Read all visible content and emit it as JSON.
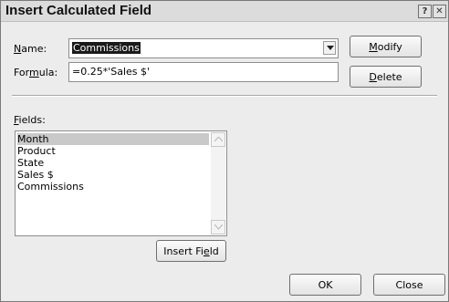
{
  "dialog": {
    "title": "Insert Calculated Field",
    "help_glyph": "?",
    "close_glyph": "✕"
  },
  "name_field": {
    "label_underlined": "N",
    "label_rest": "ame:",
    "value": "Commissions"
  },
  "formula_field": {
    "label_pre": "For",
    "label_underlined": "m",
    "label_post": "ula:",
    "value": "=0.25*'Sales $'"
  },
  "buttons": {
    "modify_underlined": "M",
    "modify_rest": "odify",
    "delete_underlined": "D",
    "delete_rest": "elete",
    "insert_field_pre": "Insert Fi",
    "insert_field_underlined": "e",
    "insert_field_post": "ld",
    "ok": "OK",
    "close": "Close"
  },
  "fields": {
    "label_underlined": "F",
    "label_rest": "ields:",
    "items": [
      "Month",
      "Product",
      "State",
      "Sales $",
      "Commissions"
    ],
    "selected_index": 0
  }
}
